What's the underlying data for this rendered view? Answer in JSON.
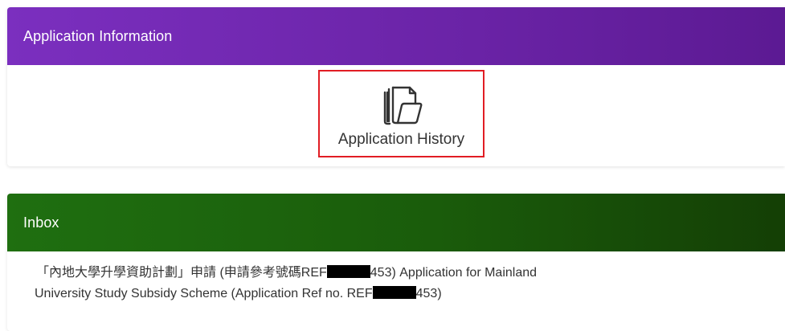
{
  "application_info": {
    "title": "Application Information",
    "history_label": "Application History",
    "history_icon": "folders-icon"
  },
  "inbox": {
    "title": "Inbox",
    "message": {
      "line1_prefix": "「內地大學升學資助計劃」申請 (申請參考號碼REF",
      "line1_suffix": "453) Application for Mainland",
      "line2_prefix": "University Study Subsidy Scheme (Application Ref no. REF",
      "line2_suffix": "453)"
    }
  },
  "colors": {
    "app_header": "#6a23a6",
    "inbox_header": "#1a5c0b",
    "highlight_border": "#e11d24"
  }
}
